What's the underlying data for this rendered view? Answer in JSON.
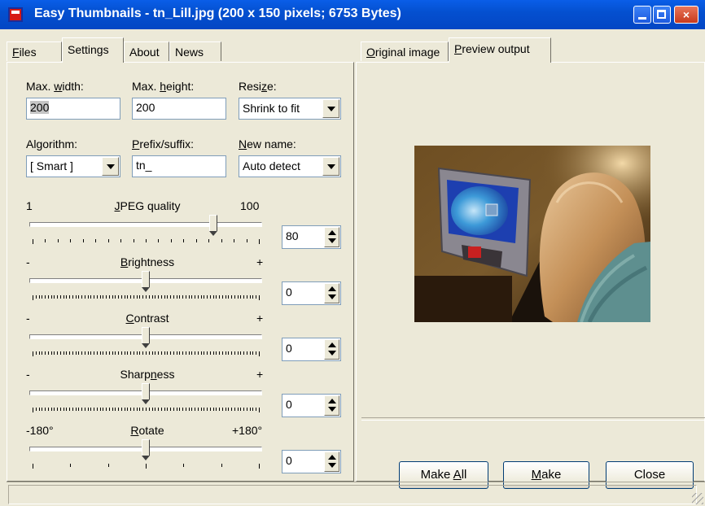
{
  "window": {
    "title": "Easy Thumbnails - tn_Lill.jpg  (200 x 150 pixels;  6753 Bytes)",
    "minimize": "minimize",
    "maximize": "maximize",
    "close": "×"
  },
  "left_tabs": [
    {
      "label": "Files",
      "u": "F",
      "rest": "iles"
    },
    {
      "label": "Settings",
      "u": "",
      "rest": "Settings"
    },
    {
      "label": "About",
      "u": "",
      "rest": "About"
    },
    {
      "label": "News",
      "u": "",
      "rest": "News"
    }
  ],
  "settings": {
    "max_width": {
      "label_pre": "Max. ",
      "label_u": "w",
      "label_post": "idth:",
      "value": "200"
    },
    "max_height": {
      "label_pre": "Max. ",
      "label_u": "h",
      "label_post": "eight:",
      "value": "200"
    },
    "resize": {
      "label_pre": "Resi",
      "label_u": "z",
      "label_post": "e:",
      "value": "Shrink to fit"
    },
    "algorithm": {
      "label_pre": "Al",
      "label_u": "g",
      "label_post": "orithm:",
      "value": "[ Smart ]"
    },
    "prefix": {
      "label_pre": "",
      "label_u": "P",
      "label_post": "refix/suffix:",
      "value": "tn_"
    },
    "new_name": {
      "label_pre": "",
      "label_u": "N",
      "label_post": "ew name:",
      "value": "Auto detect"
    }
  },
  "sliders": [
    {
      "min": "1",
      "max": "100",
      "title_pre": "",
      "title_u": "J",
      "title_post": "PEG quality",
      "value": "80",
      "position": 0.8
    },
    {
      "min": "-",
      "max": "+",
      "title_pre": "",
      "title_u": "B",
      "title_post": "rightness",
      "value": "0",
      "position": 0.5
    },
    {
      "min": "-",
      "max": "+",
      "title_pre": "",
      "title_u": "C",
      "title_post": "ontrast",
      "value": "0",
      "position": 0.5
    },
    {
      "min": "-",
      "max": "+",
      "title_pre": "Sharp",
      "title_u": "n",
      "title_post": "ess",
      "value": "0",
      "position": 0.5
    },
    {
      "min": "-180°",
      "max": "+180°",
      "title_pre": "",
      "title_u": "R",
      "title_post": "otate",
      "value": "0",
      "position": 0.5
    }
  ],
  "right_tabs": [
    {
      "pre": "",
      "u": "O",
      "post": "riginal image"
    },
    {
      "pre": "",
      "u": "P",
      "post": "review output"
    }
  ],
  "buttons": {
    "make_all": {
      "pre": "Make ",
      "u": "A",
      "post": "ll"
    },
    "make": {
      "pre": "",
      "u": "M",
      "post": "ake"
    },
    "close": {
      "pre": "Close",
      "u": "",
      "post": ""
    }
  },
  "colors": {
    "title_bar": "#0450d0",
    "window_bg": "#ece9d8"
  }
}
